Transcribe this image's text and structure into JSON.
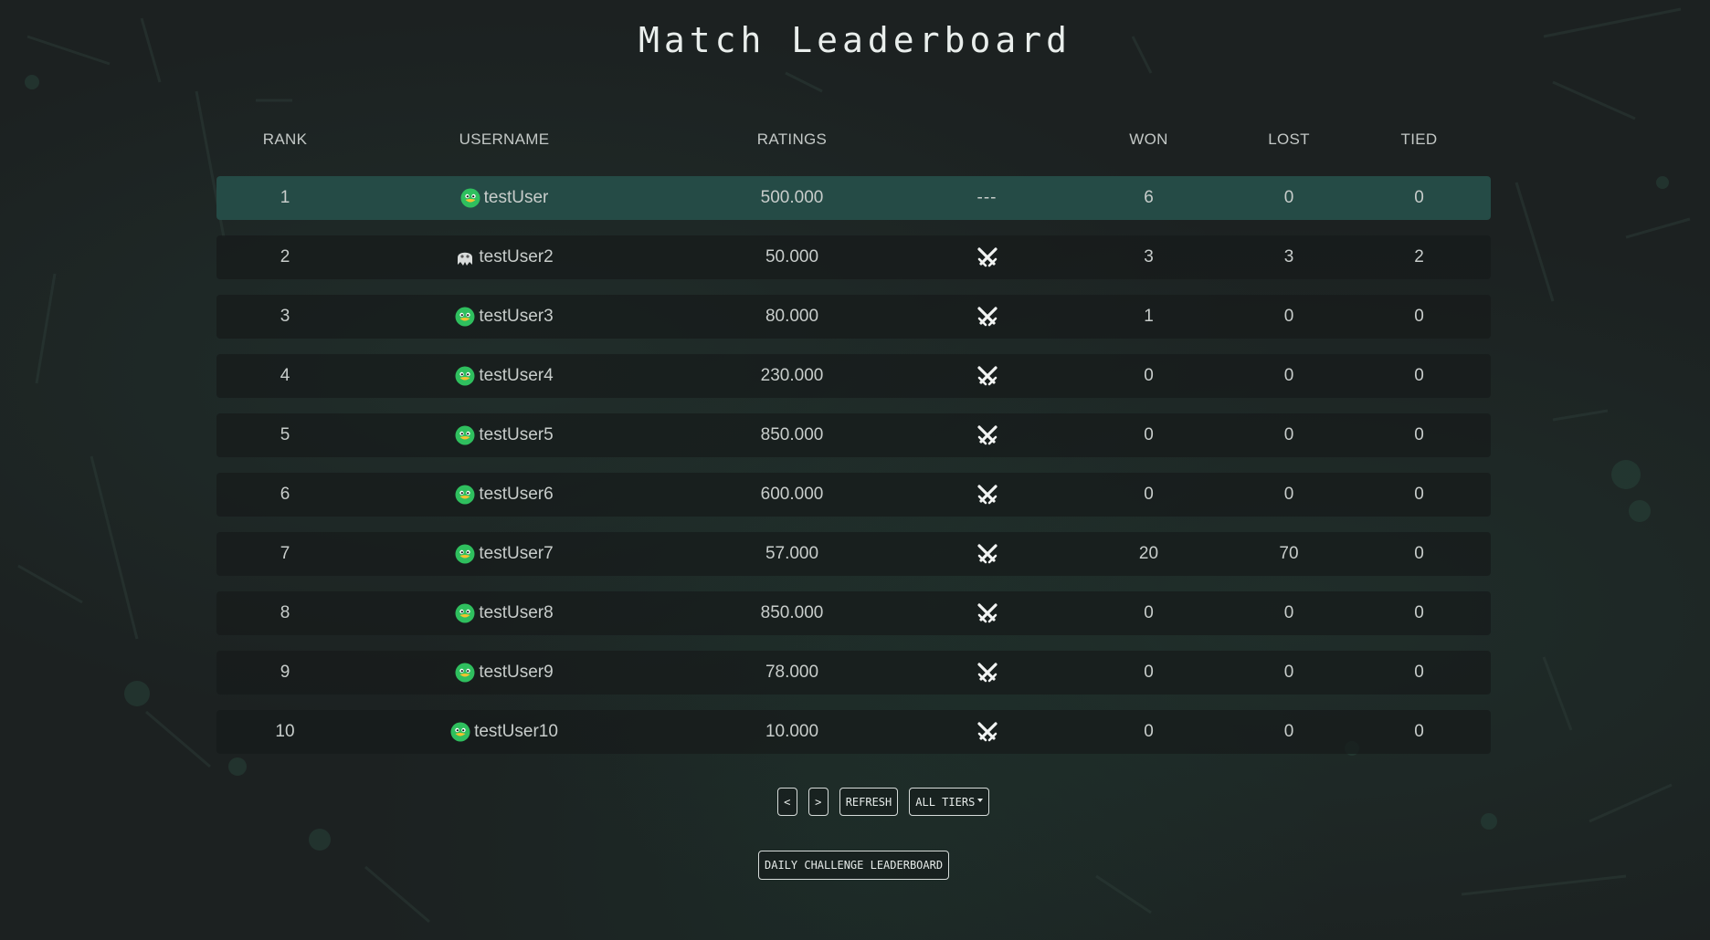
{
  "title": "Match Leaderboard",
  "columns": {
    "rank": "RANK",
    "username": "USERNAME",
    "ratings": "RATINGS",
    "action": "",
    "won": "WON",
    "lost": "LOST",
    "tied": "TIED"
  },
  "rows": [
    {
      "rank": "1",
      "username": "testUser",
      "ratings": "500.000",
      "action": "---",
      "won": "6",
      "lost": "0",
      "tied": "0",
      "avatar": "duck-avatar",
      "current_user": true
    },
    {
      "rank": "2",
      "username": "testUser2",
      "ratings": "50.000",
      "action": "swords-icon",
      "won": "3",
      "lost": "3",
      "tied": "2",
      "avatar": "ghost-avatar"
    },
    {
      "rank": "3",
      "username": "testUser3",
      "ratings": "80.000",
      "action": "swords-icon",
      "won": "1",
      "lost": "0",
      "tied": "0",
      "avatar": "duck-avatar"
    },
    {
      "rank": "4",
      "username": "testUser4",
      "ratings": "230.000",
      "action": "swords-icon",
      "won": "0",
      "lost": "0",
      "tied": "0",
      "avatar": "duck-avatar"
    },
    {
      "rank": "5",
      "username": "testUser5",
      "ratings": "850.000",
      "action": "swords-icon",
      "won": "0",
      "lost": "0",
      "tied": "0",
      "avatar": "duck-avatar"
    },
    {
      "rank": "6",
      "username": "testUser6",
      "ratings": "600.000",
      "action": "swords-icon",
      "won": "0",
      "lost": "0",
      "tied": "0",
      "avatar": "duck-avatar"
    },
    {
      "rank": "7",
      "username": "testUser7",
      "ratings": "57.000",
      "action": "swords-icon",
      "won": "20",
      "lost": "70",
      "tied": "0",
      "avatar": "duck-avatar"
    },
    {
      "rank": "8",
      "username": "testUser8",
      "ratings": "850.000",
      "action": "swords-icon",
      "won": "0",
      "lost": "0",
      "tied": "0",
      "avatar": "duck-avatar"
    },
    {
      "rank": "9",
      "username": "testUser9",
      "ratings": "78.000",
      "action": "swords-icon",
      "won": "0",
      "lost": "0",
      "tied": "0",
      "avatar": "duck-avatar"
    },
    {
      "rank": "10",
      "username": "testUser10",
      "ratings": "10.000",
      "action": "swords-icon",
      "won": "0",
      "lost": "0",
      "tied": "0",
      "avatar": "duck-avatar"
    }
  ],
  "controls": {
    "prev_label": "<",
    "next_label": ">",
    "refresh_label": "REFRESH",
    "tiers_label": "ALL TIERS",
    "daily_label": "DAILY CHALLENGE LEADERBOARD"
  },
  "colors": {
    "background": "#1c2121",
    "highlight_row": "#254b46",
    "row": "#161a1a",
    "text": "#c8cdcb",
    "avatar_green": "#2fbf5e",
    "avatar_beak": "#f2c230"
  }
}
